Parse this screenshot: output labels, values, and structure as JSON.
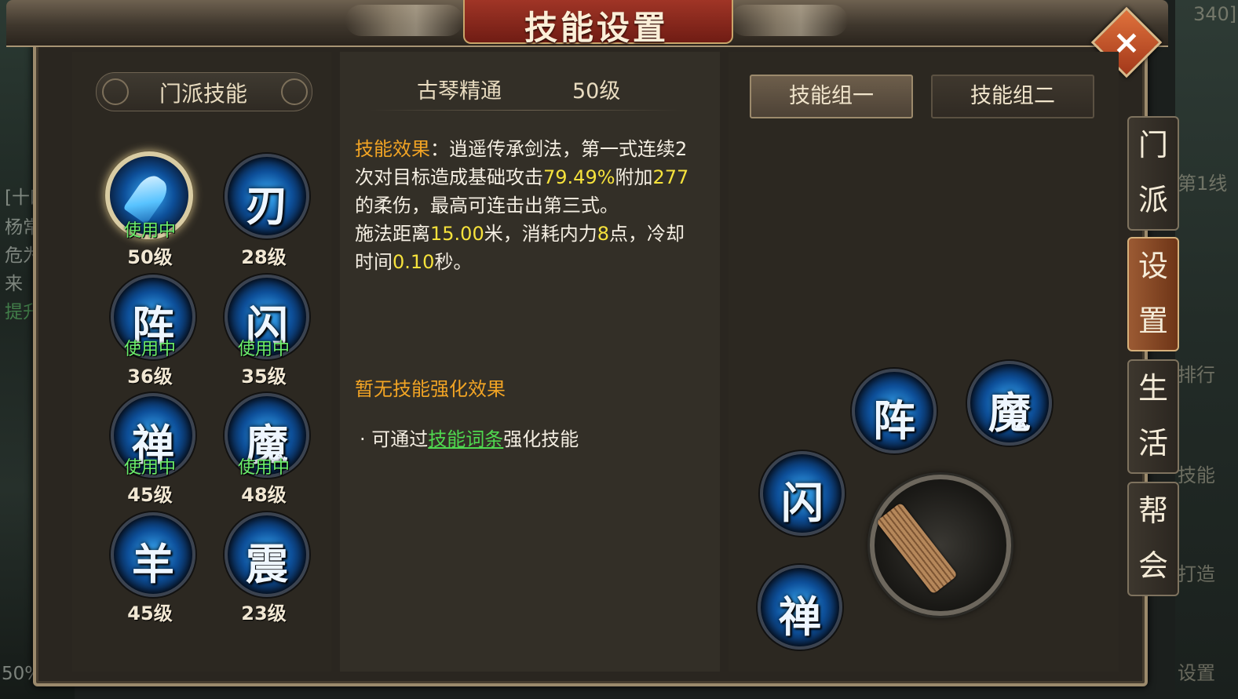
{
  "title": "技能设置",
  "close_icon_label": "×",
  "background": {
    "left_texts": [
      "[十四",
      "杨常风",
      "危为安",
      "来",
      "提升等"
    ],
    "left_percent": "50%",
    "right_texts": [
      "第1线",
      "排行",
      "技能",
      "打造",
      "设置"
    ],
    "top_right_text": "340]"
  },
  "left": {
    "header": "门派技能",
    "in_use_label": "使用中",
    "skills": [
      {
        "glyph": "",
        "level": "50级",
        "in_use": true,
        "selected": true
      },
      {
        "glyph": "刃",
        "level": "28级",
        "in_use": false
      },
      {
        "glyph": "阵",
        "level": "36级",
        "in_use": true
      },
      {
        "glyph": "闪",
        "level": "35级",
        "in_use": true
      },
      {
        "glyph": "禅",
        "level": "45级",
        "in_use": true
      },
      {
        "glyph": "魔",
        "level": "48级",
        "in_use": true
      },
      {
        "glyph": "羊",
        "level": "45级",
        "in_use": false
      },
      {
        "glyph": "震",
        "level": "23级",
        "in_use": false
      }
    ]
  },
  "detail": {
    "name": "古琴精通",
    "level": "50级",
    "effect_label": "技能效果",
    "colon": "：",
    "effect_text_1": "逍遥传承剑法，第一式连续2次对目标造成基础攻击",
    "attack_pct": "79.49%",
    "effect_text_2": "附加",
    "soft_damage": "277",
    "effect_text_3": "的柔伤，最高可连击出第三式。",
    "cast_prefix": "施法距离",
    "distance": "15.00",
    "cast_mid": "米，消耗内力",
    "mp_cost": "8",
    "cast_mid2": "点，冷却时间",
    "cooldown": "0.10",
    "cast_suffix": "秒。",
    "no_enhancement": "暂无技能强化效果",
    "tip_prefix": "· 可通过",
    "tip_link": "技能词条",
    "tip_suffix": "强化技能"
  },
  "groups": {
    "tab1": "技能组一",
    "tab2": "技能组二",
    "slots": [
      "阵",
      "魔",
      "闪",
      "禅"
    ]
  },
  "side_tabs": [
    {
      "label": "门派",
      "active": false
    },
    {
      "label": "设置",
      "active": true
    },
    {
      "label": "生活",
      "active": false
    },
    {
      "label": "帮会",
      "active": false
    }
  ]
}
